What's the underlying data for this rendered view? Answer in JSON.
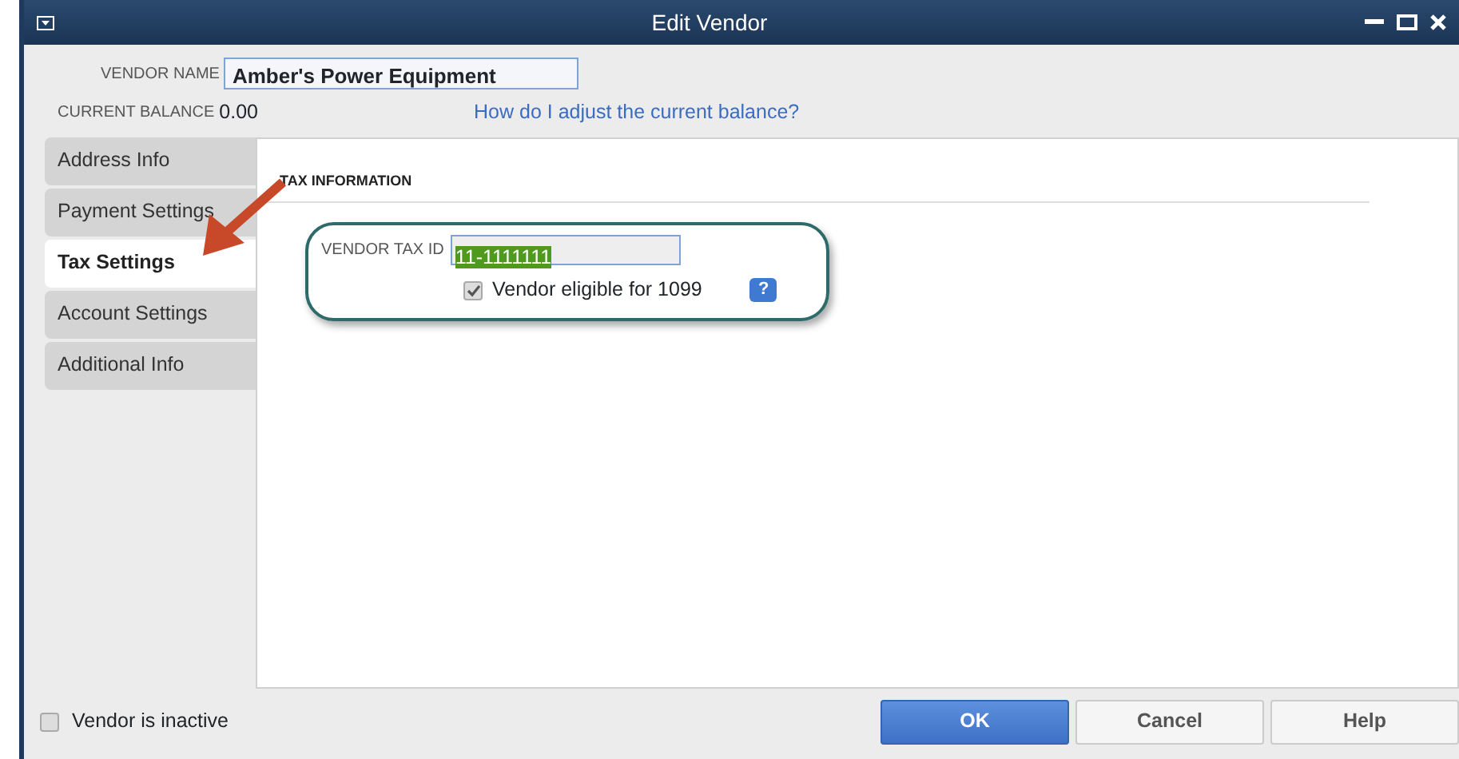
{
  "window": {
    "title": "Edit Vendor"
  },
  "vendor_name": {
    "label": "VENDOR NAME",
    "value": "Amber's Power Equipment"
  },
  "current_balance": {
    "label": "CURRENT BALANCE",
    "value": "0.00",
    "help_link": "How do I adjust the current balance?"
  },
  "tabs": [
    {
      "label": "Address Info",
      "selected": false
    },
    {
      "label": "Payment Settings",
      "selected": false
    },
    {
      "label": "Tax Settings",
      "selected": true
    },
    {
      "label": "Account Settings",
      "selected": false
    },
    {
      "label": "Additional Info",
      "selected": false
    }
  ],
  "tax_information": {
    "heading": "TAX INFORMATION",
    "tax_id_label": "VENDOR TAX ID",
    "tax_id": "11-1111111",
    "eligible_1099": {
      "label": "Vendor eligible for 1099",
      "checked": true
    },
    "help_button": "?"
  },
  "vendor_inactive": {
    "label": "Vendor is inactive",
    "checked": false
  },
  "buttons": [
    {
      "label": "OK",
      "kind": "primary"
    },
    {
      "label": "Cancel",
      "kind": "default"
    },
    {
      "label": "Help",
      "kind": "default"
    }
  ]
}
